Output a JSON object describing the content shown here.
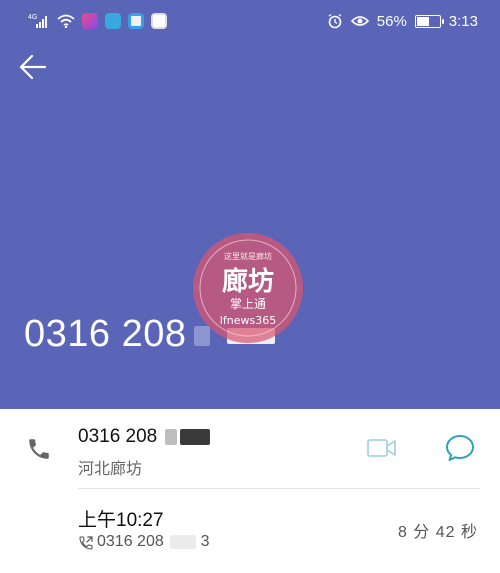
{
  "status_bar": {
    "network": "4G",
    "battery": "56%",
    "battery_level": 0.56,
    "time": "3:13"
  },
  "header": {
    "back_icon": "back-arrow-icon",
    "caller_number": "0316 208",
    "background_color": "#5a65b8"
  },
  "watermark": {
    "top_text": "这里就是廊坊",
    "title": "廊坊",
    "subtitle": "掌上通",
    "handle": "lfnews365"
  },
  "contact_row": {
    "number": "0316 208",
    "location": "河北廊坊",
    "video_icon": "video-call-icon",
    "message_icon": "message-icon"
  },
  "call_log": {
    "time": "上午10:27",
    "number": "0316 208",
    "number_tail": "3",
    "direction_icon": "outgoing-call-icon",
    "duration": "8 分 42 秒"
  }
}
